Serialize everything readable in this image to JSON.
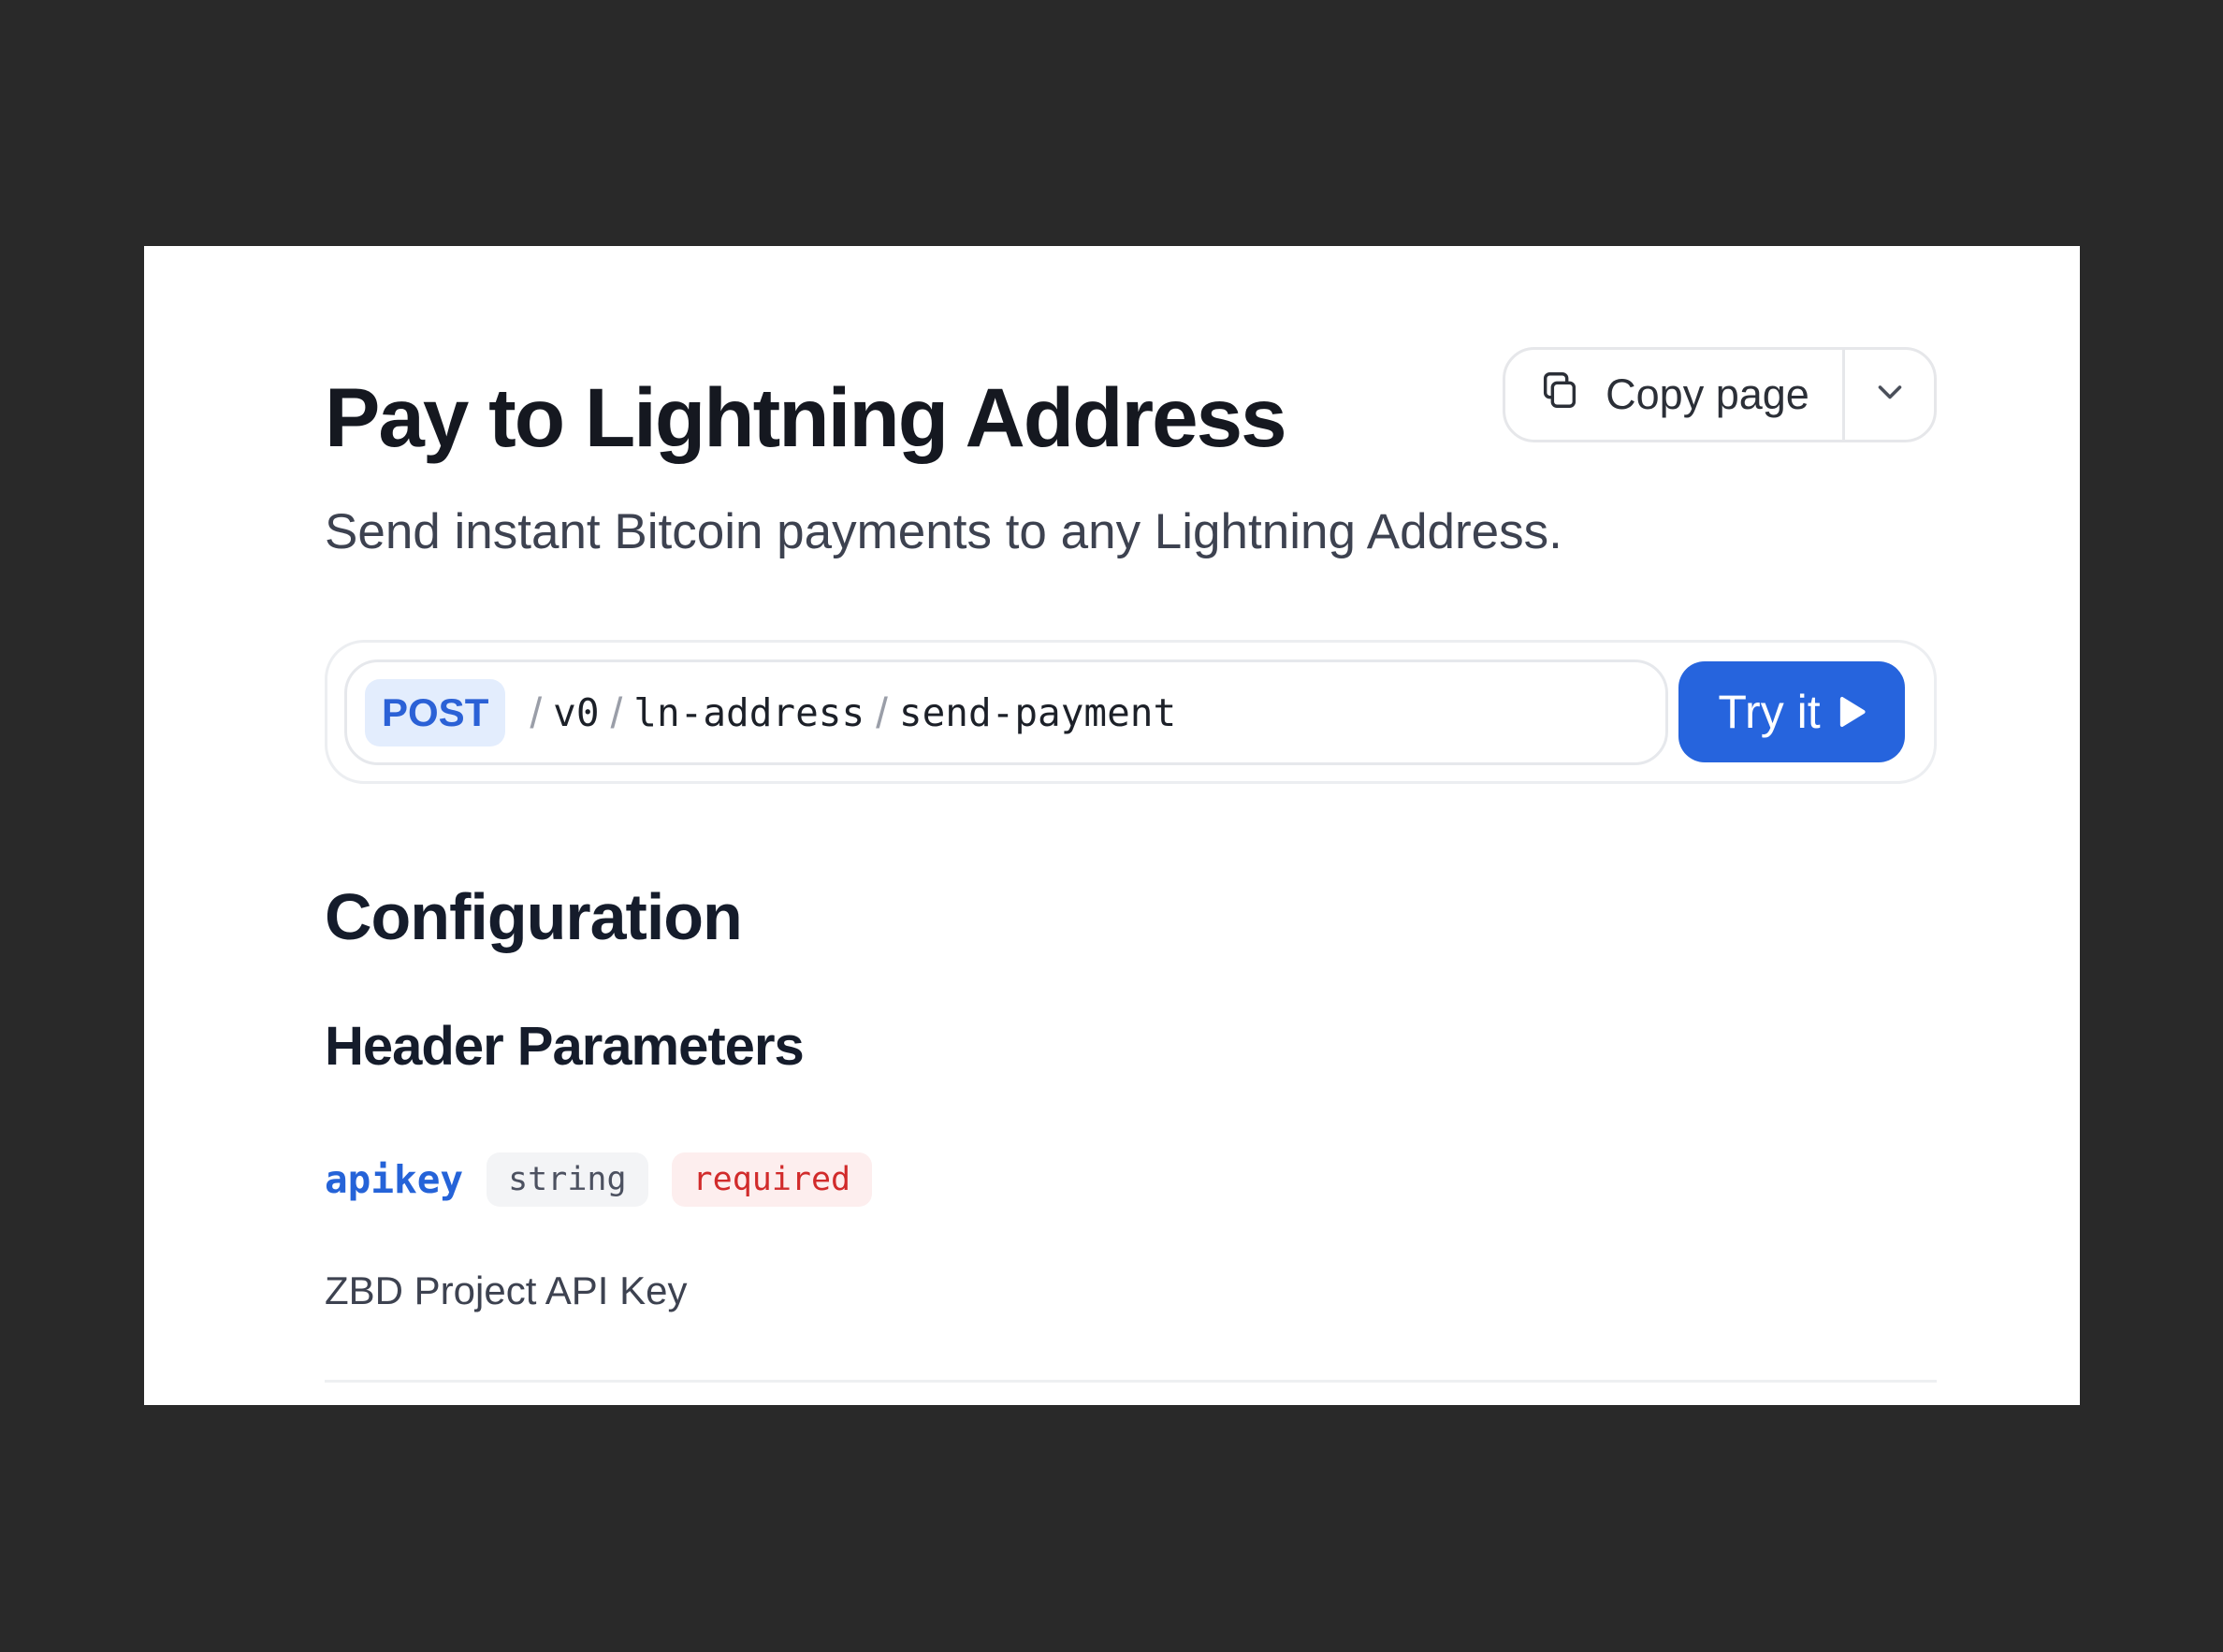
{
  "page": {
    "title": "Pay to Lightning Address",
    "subtitle": "Send instant Bitcoin payments to any Lightning Address."
  },
  "toolbar": {
    "copy_label": "Copy page",
    "copy_icon": "copy-icon",
    "menu_icon": "chevron-down-icon"
  },
  "endpoint": {
    "method": "POST",
    "path_segments": [
      "v0",
      "ln-address",
      "send-payment"
    ],
    "try_label": "Try it",
    "try_icon": "play-icon"
  },
  "config": {
    "heading": "Configuration",
    "header_params_heading": "Header Parameters",
    "params": [
      {
        "name": "apikey",
        "type": "string",
        "required_label": "required",
        "description": "ZBD Project API Key"
      }
    ]
  },
  "colors": {
    "background": "#292929",
    "accent": "#2664dd",
    "method_bg": "#e3edfd",
    "required_text": "#d12b2b"
  }
}
